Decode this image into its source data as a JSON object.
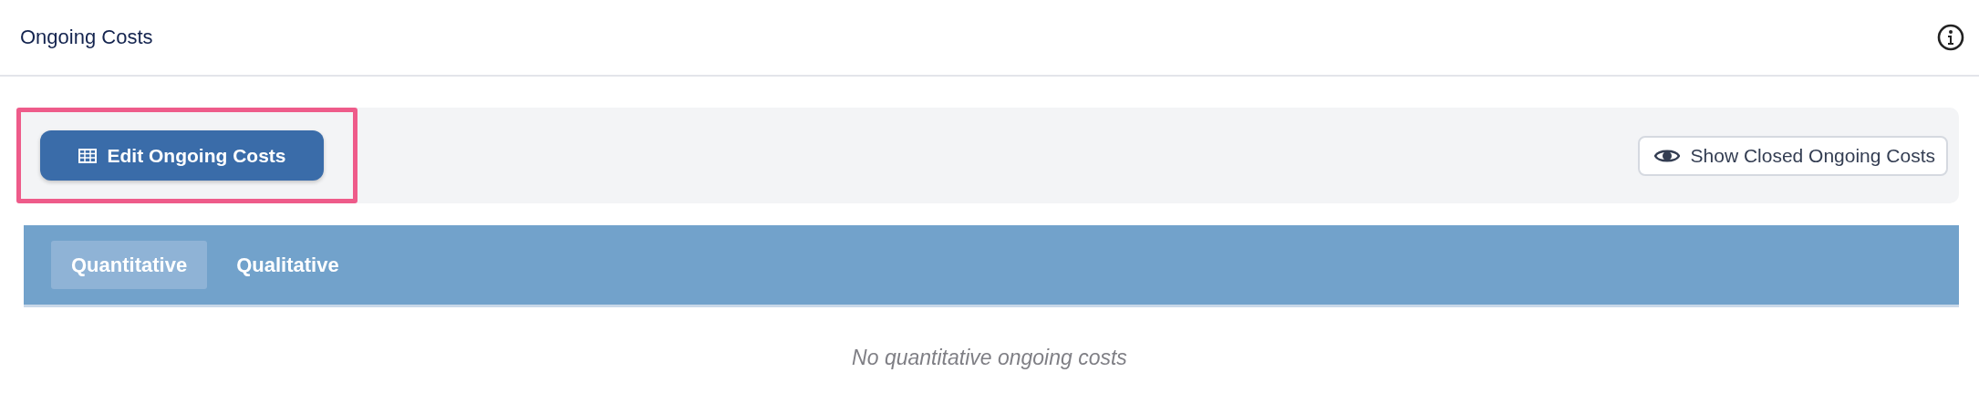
{
  "header": {
    "title": "Ongoing Costs"
  },
  "toolbar": {
    "edit_button": {
      "label": "Edit Ongoing Costs",
      "highlighted": true
    },
    "closed_button": {
      "label": "Show Closed Ongoing Costs"
    }
  },
  "tabs": [
    {
      "label": "Quantitative",
      "selected": true
    },
    {
      "label": "Qualitative",
      "selected": false
    }
  ],
  "empty_message": "No quantitative ongoing costs"
}
